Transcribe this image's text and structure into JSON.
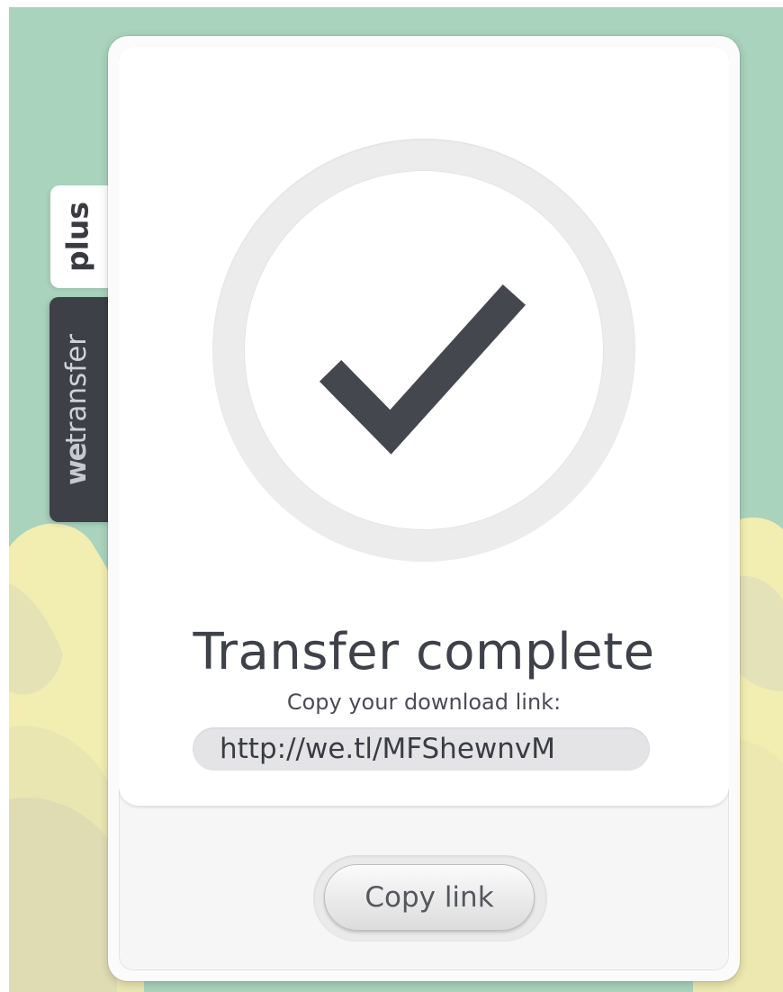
{
  "colors": {
    "background_green": "#a9d3bd",
    "cloud_yellow": "#f3efb4",
    "tab_dark": "#3e4047",
    "checkmark": "#45474f",
    "title_text": "#3f414a"
  },
  "side_tabs": {
    "plus_label": "plus",
    "brand_prefix": "we",
    "brand_suffix": "transfer"
  },
  "status": {
    "icon": "checkmark-icon",
    "title": "Transfer complete",
    "subtitle": "Copy your download link:"
  },
  "link": {
    "value": "http://we.tl/MFShewnvM"
  },
  "actions": {
    "copy_label": "Copy link"
  }
}
